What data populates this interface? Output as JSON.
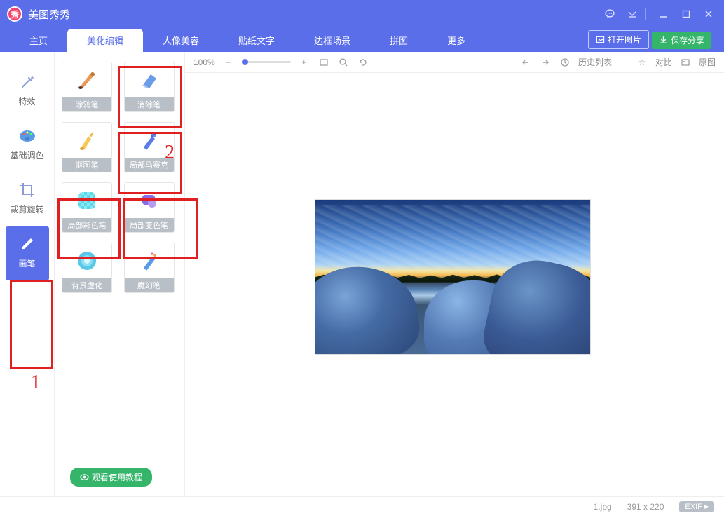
{
  "app": {
    "title": "美图秀秀"
  },
  "window_controls": {
    "speech": "speech",
    "dropdown": "dropdown",
    "min": "min",
    "max": "max",
    "close": "close"
  },
  "tabs": {
    "home": "主页",
    "beautify": "美化编辑",
    "portrait": "人像美容",
    "sticker": "贴纸文字",
    "frame": "边框场景",
    "puzzle": "拼图",
    "more": "更多"
  },
  "top_buttons": {
    "open": "打开图片",
    "save": "保存分享"
  },
  "rail": {
    "effects": "特效",
    "basic": "基础调色",
    "crop": "裁剪旋转",
    "brush": "画笔"
  },
  "tools": {
    "doodle": "涂鸦笔",
    "eraser": "消除笔",
    "cutout": "抠图笔",
    "mosaic": "局部马赛克",
    "color": "局部彩色笔",
    "recolor": "局部变色笔",
    "bgblur": "背景虚化",
    "magic": "魔幻笔"
  },
  "watch_tutorial": "观看使用教程",
  "canvas_toolbar": {
    "zoom": "100%",
    "history": "历史列表",
    "compare": "对比",
    "original": "原图"
  },
  "statusbar": {
    "filename": "1.jpg",
    "dimensions": "391 x 220",
    "exif": "EXIF"
  },
  "annotations": {
    "num1": "1",
    "num2": "2"
  }
}
